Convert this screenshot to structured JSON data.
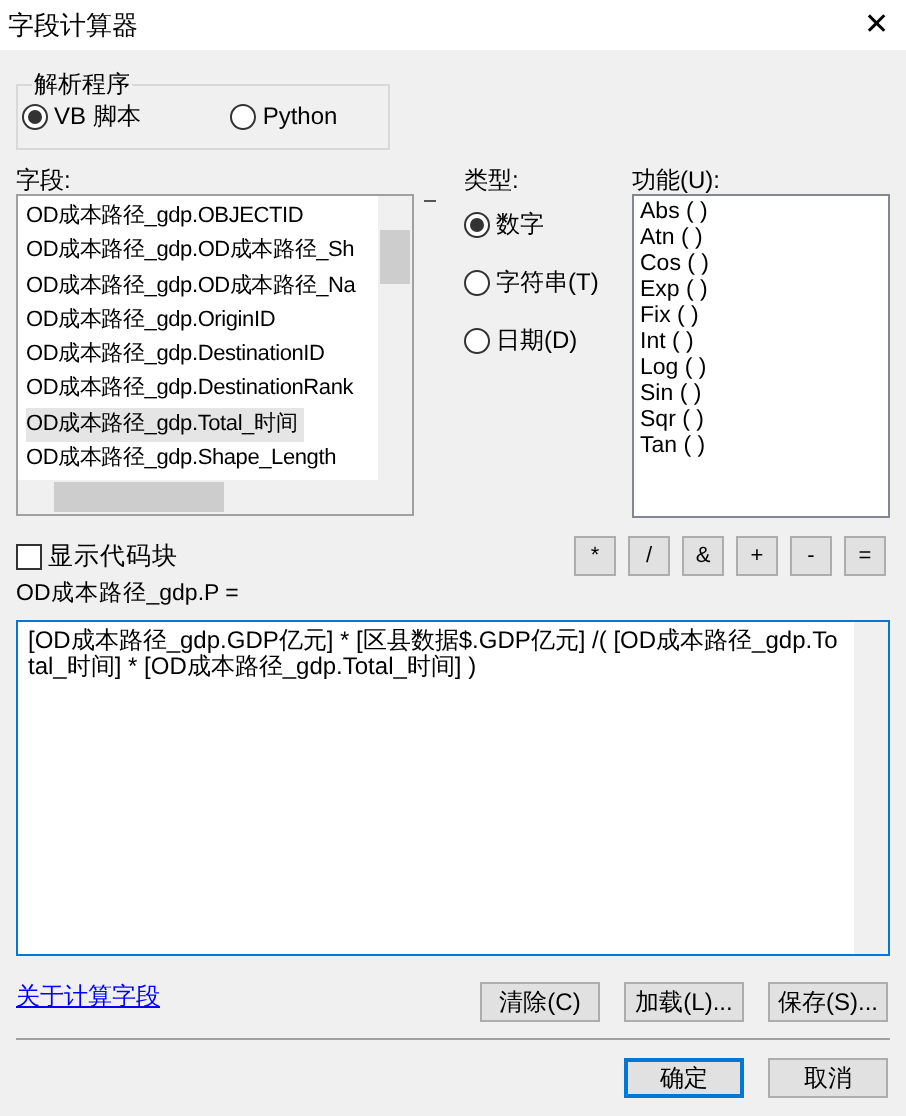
{
  "window": {
    "title": "字段计算器",
    "close": "✕"
  },
  "parser": {
    "title": "解析程序",
    "options": [
      {
        "label": "VB 脚本",
        "selected": true
      },
      {
        "label": "Python",
        "selected": false
      }
    ]
  },
  "fields": {
    "label": "字段:",
    "items": [
      {
        "label": "OD成本路径_gdp.OBJECTID",
        "selected": false
      },
      {
        "label": "OD成本路径_gdp.OD成本路径_Sh",
        "selected": false
      },
      {
        "label": "OD成本路径_gdp.OD成本路径_Na",
        "selected": false
      },
      {
        "label": "OD成本路径_gdp.OriginID",
        "selected": false
      },
      {
        "label": "OD成本路径_gdp.DestinationID",
        "selected": false
      },
      {
        "label": "OD成本路径_gdp.DestinationRank",
        "selected": false
      },
      {
        "label": "OD成本路径_gdp.Total_时间",
        "selected": true
      },
      {
        "label": "OD成本路径_gdp.Shape_Length",
        "selected": false
      }
    ]
  },
  "type": {
    "label": "类型:",
    "options": [
      {
        "label": "数字",
        "selected": true
      },
      {
        "label": "字符串(T)",
        "selected": false
      },
      {
        "label": "日期(D)",
        "selected": false
      }
    ]
  },
  "functions": {
    "label": "功能(U):",
    "items": [
      "Abs ( )",
      "Atn ( )",
      "Cos ( )",
      "Exp ( )",
      "Fix ( )",
      "Int ( )",
      "Log ( )",
      "Sin ( )",
      "Sqr ( )",
      "Tan ( )"
    ]
  },
  "show_codeblock": {
    "label": "显示代码块",
    "checked": false
  },
  "operators": [
    "*",
    "/",
    "&",
    "+",
    "-",
    "="
  ],
  "expression_label": "OD成本路径_gdp.P =",
  "expression": "[OD成本路径_gdp.GDP亿元] * [区县数据$.GDP亿元] /( [OD成本路径_gdp.Total_时间] * [OD成本路径_gdp.Total_时间] )",
  "help_link": "关于计算字段",
  "file_buttons": [
    "清除(C)",
    "加载(L)...",
    "保存(S)..."
  ],
  "dialog_buttons": [
    {
      "label": "确定",
      "default": true
    },
    {
      "label": "取消",
      "default": false
    }
  ]
}
